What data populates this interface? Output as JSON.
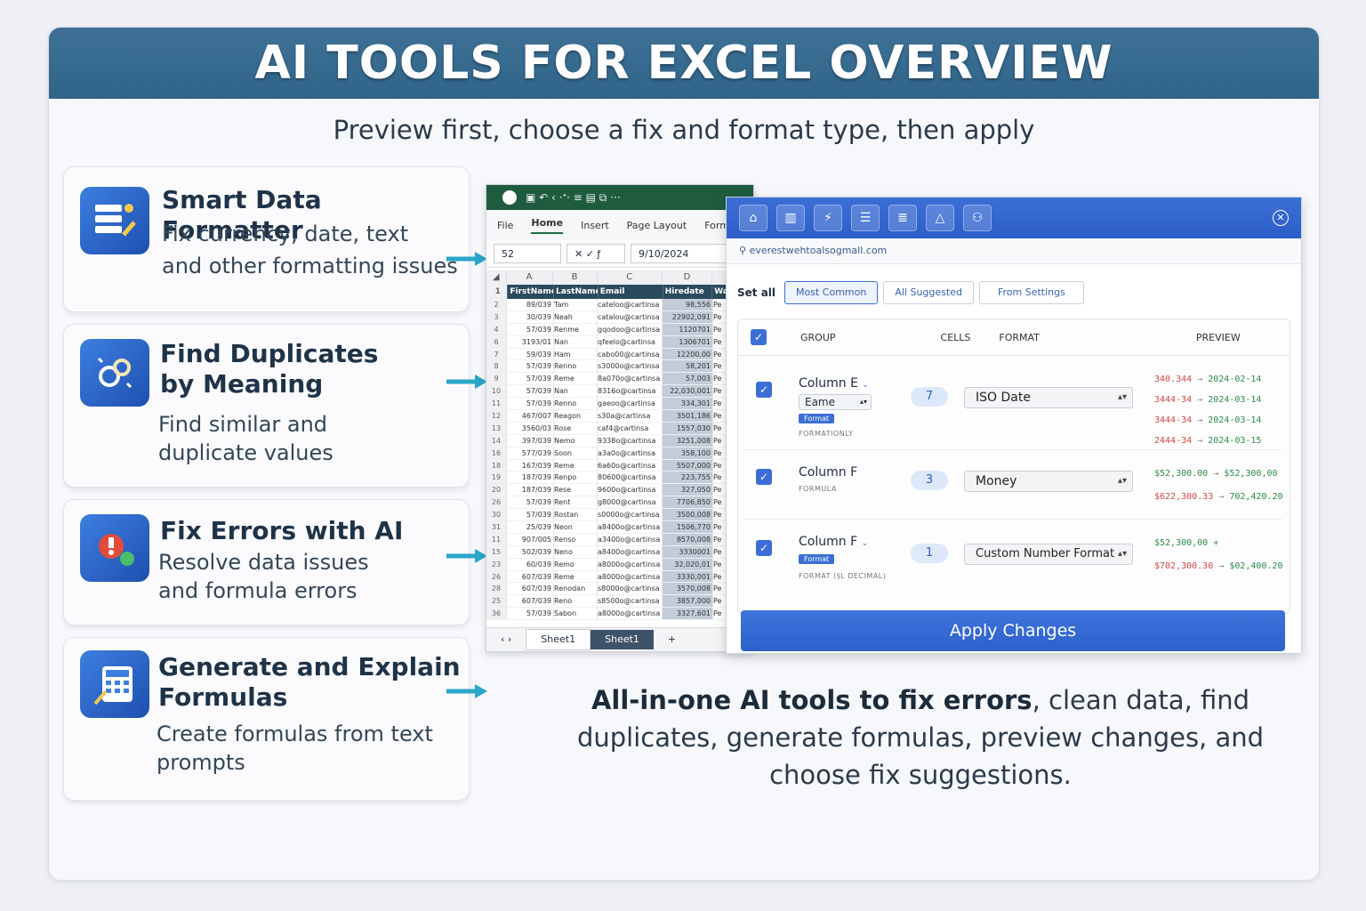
{
  "banner": {
    "title": "AI TOOLS FOR EXCEL OVERVIEW"
  },
  "subtitle": "Preview first, choose a fix and format type, then apply",
  "features": [
    {
      "title": "Smart Data Formatter",
      "desc": [
        "Fix currency, date, text",
        "and other formatting issues"
      ],
      "icon": "formatter-icon"
    },
    {
      "title": "Find Duplicates",
      "title2": "by Meaning",
      "desc": [
        "Find similar and",
        "duplicate values"
      ],
      "icon": "duplicates-icon"
    },
    {
      "title": "Fix Errors with AI",
      "desc": [
        "Resolve data issues",
        "and formula errors"
      ],
      "icon": "fix-errors-icon"
    },
    {
      "title": "Generate and Explain",
      "title2": "Formulas",
      "desc": [
        "Create formulas from text",
        "prompts"
      ],
      "icon": "formulas-icon"
    }
  ],
  "excel": {
    "menu": [
      "File",
      "Home",
      "Insert",
      "Page Layout",
      "Formulas"
    ],
    "active_menu": "Home",
    "name_box": "52",
    "formula_value": "9/10/2024",
    "columns": [
      "A",
      "B",
      "C",
      "D",
      "E"
    ],
    "header_row": [
      "FirstName",
      "LastName",
      "Email",
      "Hiredate",
      "Wa"
    ],
    "rows": [
      [
        "2",
        "89/039",
        "Tam",
        "cateloo@cartinsa",
        "98,556",
        "Pe"
      ],
      [
        "3",
        "30/039",
        "Neah",
        "catalou@cartinsa",
        "22902,091",
        "Pe"
      ],
      [
        "4",
        "57/039",
        "Renme",
        "gqodoo@cartinsa",
        "1120701",
        "Pe"
      ],
      [
        "6",
        "3193/01",
        "Nan",
        "qfeelo@cartinsa",
        "1306701",
        "Pe"
      ],
      [
        "7",
        "59/039",
        "Ham",
        "cabo00@cartinsa",
        "12200,00",
        "Pe"
      ],
      [
        "8",
        "57/039",
        "Renno",
        "s3000o@cartinsa",
        "58,201",
        "Pe"
      ],
      [
        "9",
        "57/039",
        "Reme",
        "8a070o@cartinsa",
        "57,003",
        "Pe"
      ],
      [
        "10",
        "57/039",
        "Nan",
        "8316o@cartinsa",
        "22,030,001",
        "Pe"
      ],
      [
        "11",
        "57/039",
        "Renno",
        "gaeoo@cartinsa",
        "334,301",
        "Pe"
      ],
      [
        "12",
        "467/007",
        "Reagon",
        "s30a@cartinsa",
        "3501,186",
        "Pe"
      ],
      [
        "13",
        "3560/03",
        "Rose",
        "caf4@cartinsa",
        "1557,030",
        "Pe"
      ],
      [
        "14",
        "397/039",
        "Nemo",
        "9338o@cartinsa",
        "3251,008",
        "Pe"
      ],
      [
        "16",
        "577/039",
        "Soon",
        "a3a0o@cartinsa",
        "358,100",
        "Pe"
      ],
      [
        "18",
        "167/039",
        "Reme",
        "6a60o@cartinsa",
        "5507,000",
        "Pe"
      ],
      [
        "19",
        "187/039",
        "Renpo",
        "80600@cartinsa",
        "223,755",
        "Pe"
      ],
      [
        "20",
        "187/039",
        "Rese",
        "9600o@cartinsa",
        "327,050",
        "Pe"
      ],
      [
        "26",
        "57/039",
        "Rent",
        "g8000@cartinsa",
        "7706,850",
        "Pe"
      ],
      [
        "30",
        "57/039",
        "Rostan",
        "s0000o@cartinsa",
        "3500,008",
        "Pe"
      ],
      [
        "31",
        "25/039",
        "Neon",
        "a8400o@cartinsa",
        "1506,770",
        "Pe"
      ],
      [
        "11",
        "907/005",
        "Renso",
        "a3400o@cartinsa",
        "8570,008",
        "Pe"
      ],
      [
        "15",
        "502/039",
        "Neno",
        "a8400o@cartinsa",
        "3330001",
        "Pe"
      ],
      [
        "23",
        "60/039",
        "Remo",
        "a8000o@cartinsa",
        "32,020,01",
        "Pe"
      ],
      [
        "26",
        "607/039",
        "Reme",
        "a8000o@cartinsa",
        "3330,001",
        "Pe"
      ],
      [
        "28",
        "607/039",
        "Renodan",
        "s8000o@cartinsa",
        "3570,008",
        "Pe"
      ],
      [
        "25",
        "607/039",
        "Reno",
        "s8500o@cartinsa",
        "3857,000",
        "Pe"
      ],
      [
        "36",
        "57/039",
        "Sabon",
        "a8000o@cartinsa",
        "3327,601",
        "Pe"
      ]
    ],
    "sheet_tabs": [
      "Sheet1",
      "Sheet1"
    ]
  },
  "panel": {
    "email": "everestwehtoalsogmall.com",
    "set_all_label": "Set all",
    "filters": [
      "Most Common",
      "All Suggested",
      "From Settings"
    ],
    "columns": [
      "GROUP",
      "CELLS",
      "FORMAT",
      "PREVIEW"
    ],
    "rows": [
      {
        "group": "Column E",
        "sub_select": "Eame",
        "tag": "Format",
        "note": "FORMATIONLY",
        "cells": "7",
        "format": "ISO Date",
        "preview": [
          [
            "340.344",
            "2024-02-14"
          ],
          [
            "3444-34",
            "2024-03-14"
          ],
          [
            "3444-34",
            "2024-03-14"
          ],
          [
            "2444-34",
            "2024-03-15"
          ]
        ]
      },
      {
        "group": "Column F",
        "note": "FORMULA",
        "cells": "3",
        "format": "Money",
        "preview": [
          [
            "$52,300.00",
            "$52,300,00"
          ],
          [
            "$622,300.33",
            "702,420.20"
          ]
        ]
      },
      {
        "group": "Column F",
        "tag": "Format",
        "note": "FORMAT (§L DECIMAL)",
        "cells": "1",
        "format": "Custom Number Format",
        "preview": [
          [
            "$52,300,00 +",
            ""
          ],
          [
            "$702,300.30",
            "$02,400.20"
          ]
        ]
      }
    ],
    "apply_label": "Apply Changes"
  },
  "summary": {
    "bold": "All-in-one AI tools to fix errors",
    "rest": ", clean data, find duplicates, generate formulas, preview changes, and choose fix suggestions."
  },
  "colors": {
    "banner": "#3f7196",
    "accent": "#3b6fd6",
    "excel_green": "#1f5c3f"
  }
}
